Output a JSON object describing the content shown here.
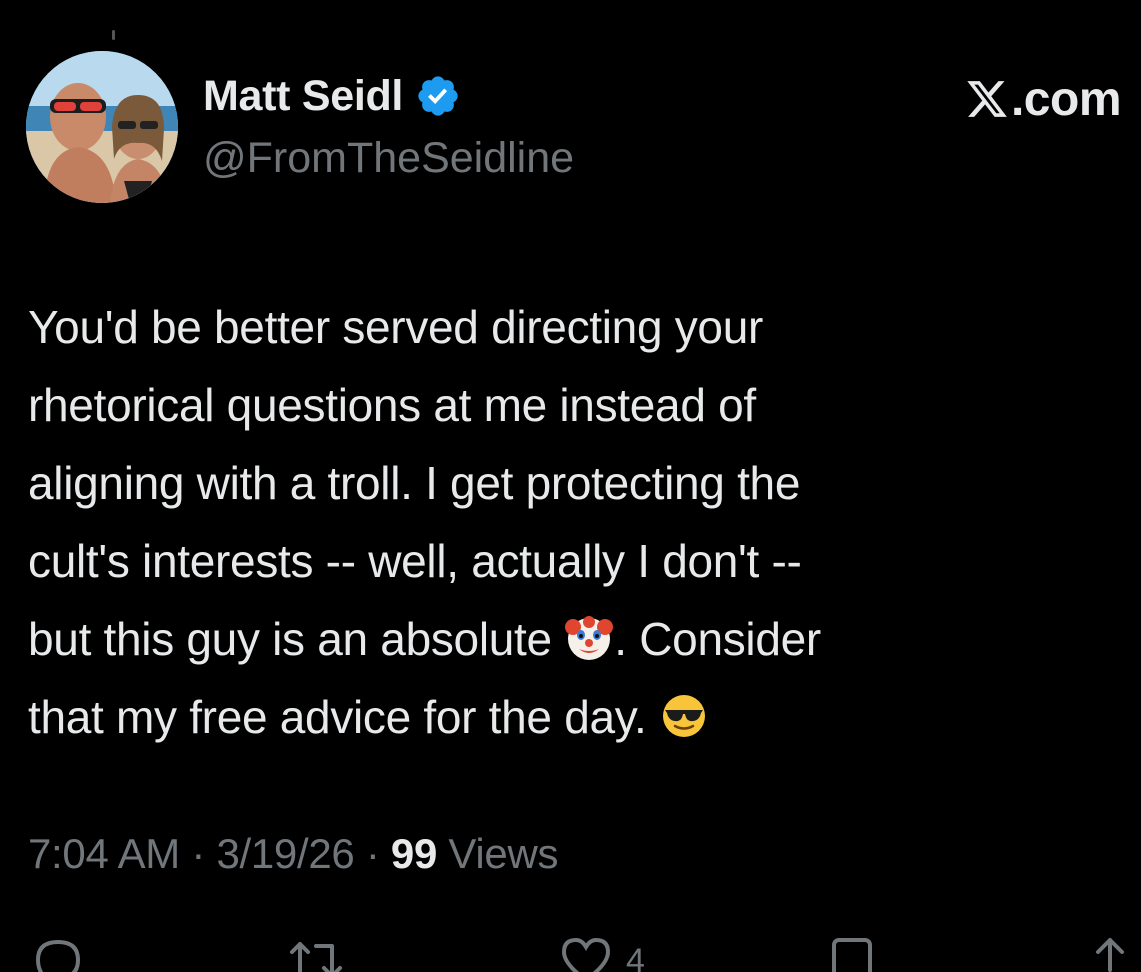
{
  "user": {
    "display_name": "Matt Seidl",
    "handle": "@FromTheSeidline",
    "verified": true
  },
  "brand": {
    "domain": ".com",
    "logo_icon": "x-logo-icon"
  },
  "tweet": {
    "lines": [
      "You'd be better served directing your",
      "rhetorical questions at me instead of",
      "aligning with a troll. I get protecting the",
      "cult's interests -- well, actually I don't --",
      "but this guy is an absolute ",
      ". Consider",
      "that my free advice for the day. "
    ],
    "emojis": [
      "clown-face",
      "smiling-face-with-sunglasses"
    ]
  },
  "meta": {
    "time": "7:04 AM",
    "separator": " · ",
    "date": "3/19/26",
    "views_count": "99",
    "views_label": " Views"
  },
  "actions": {
    "like_count": "4"
  },
  "colors": {
    "background": "#000000",
    "text_primary": "#e7e9ea",
    "text_secondary": "#71767b",
    "verified_blue": "#1d9bf0"
  }
}
